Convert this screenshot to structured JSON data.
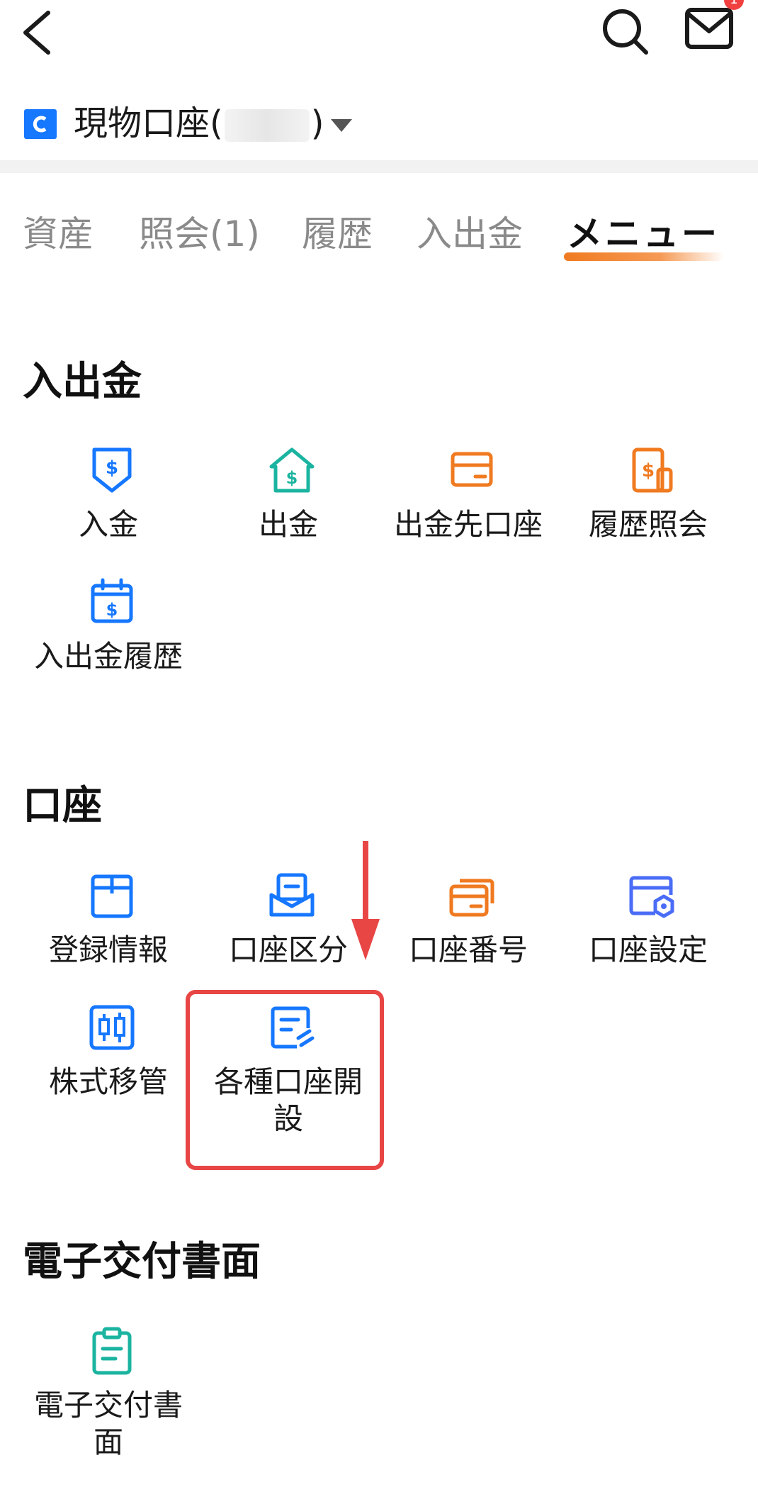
{
  "header": {
    "back_icon": "chevron-left-icon",
    "search_icon": "search-icon",
    "mail_icon": "mail-icon",
    "mail_badge": "1"
  },
  "account": {
    "name_prefix": "現物口座(",
    "name_suffix": ")",
    "caret_icon": "caret-down-icon",
    "logo_color": "#1677ff"
  },
  "tabs": [
    {
      "label": "資産",
      "active": false
    },
    {
      "label": "照会(1)",
      "active": false
    },
    {
      "label": "履歴",
      "active": false
    },
    {
      "label": "入出金",
      "active": false
    },
    {
      "label": "メニュー",
      "active": true
    }
  ],
  "sections": {
    "deposit": {
      "title": "入出金",
      "items": [
        {
          "label": "入金",
          "icon": "deposit-icon"
        },
        {
          "label": "出金",
          "icon": "withdraw-icon"
        },
        {
          "label": "出金先口座",
          "icon": "bank-card-icon"
        },
        {
          "label": "履歴照会",
          "icon": "history-document-icon"
        },
        {
          "label": "入出金履歴",
          "icon": "calendar-dollar-icon"
        }
      ]
    },
    "account": {
      "title": "口座",
      "items": [
        {
          "label": "登録情報",
          "icon": "registration-icon"
        },
        {
          "label": "口座区分",
          "icon": "account-type-icon"
        },
        {
          "label": "口座番号",
          "icon": "account-number-icon"
        },
        {
          "label": "口座設定",
          "icon": "account-settings-icon"
        },
        {
          "label": "株式移管",
          "icon": "stock-transfer-icon"
        },
        {
          "label": "各種口座開設",
          "icon": "account-opening-icon"
        }
      ]
    },
    "edocs": {
      "title": "電子交付書面",
      "items": [
        {
          "label": "電子交付書面",
          "icon": "clipboard-icon"
        }
      ]
    }
  },
  "colors": {
    "blue": "#1677ff",
    "teal": "#1bb4a0",
    "orange": "#f07a20",
    "highlight_red": "#e84545"
  }
}
